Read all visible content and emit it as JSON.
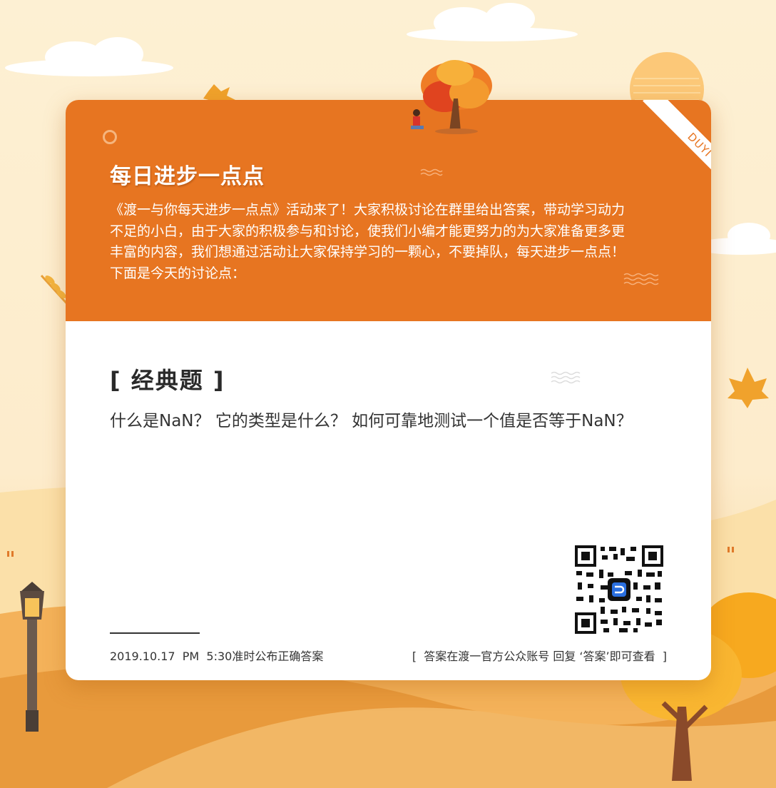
{
  "card": {
    "title": "每日进步一点点",
    "intro": "《渡一与你每天进步一点点》活动来了！大家积极讨论在群里给出答案，带动学习动力不足的小白，由于大家的积极参与和讨论，使我们小编才能更努力的为大家准备更多更丰富的内容，我们想通过活动让大家保持学习的一颗心，不要掉队，每天进步一点点！下面是今天的讨论点：",
    "ribbon": "DUYI",
    "section_title": "[ 经典题 ]",
    "question": "什么是NaN？ 它的类型是什么？ 如何可靠地测试一个值是否等于NaN？",
    "footer_left": "2019.10.17  PM  5:30准时公布正确答案",
    "footer_right": "[  答案在渡一官方公众账号 回复 ‘答案’即可查看  ]"
  },
  "colors": {
    "accent": "#e77521",
    "background": "#fdf0d3",
    "card": "#ffffff",
    "text": "#333333"
  },
  "icons": [
    "maple-leaf-icon",
    "sun-icon",
    "cloud-icon",
    "tree-icon",
    "street-lamp-icon",
    "qr-code-icon",
    "wave-icon",
    "ring-icon"
  ]
}
